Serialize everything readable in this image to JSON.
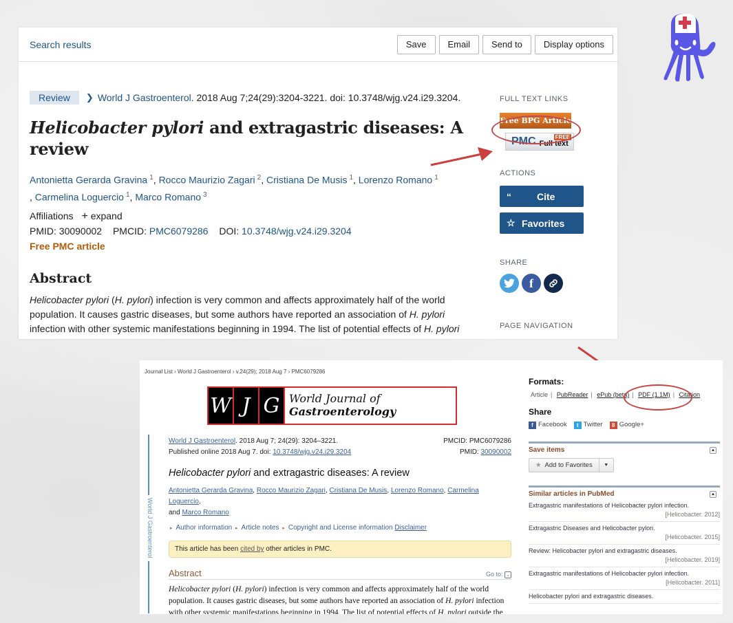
{
  "pubmed": {
    "topbar": {
      "search_results": "Search results",
      "buttons": [
        "Save",
        "Email",
        "Send to",
        "Display options"
      ]
    },
    "article_type": "Review",
    "citation": {
      "journal": "World J Gastroenterol",
      "rest": ". 2018 Aug 7;24(29):3204-3221. doi: 10.3748/wjg.v24.i29.3204."
    },
    "title": {
      "italic": "Helicobacter pylori",
      "rest": " and extragastric diseases: A review"
    },
    "authors": [
      {
        "name": "Antonietta Gerarda Gravina",
        "aff": "1"
      },
      {
        "name": "Rocco Maurizio Zagari",
        "aff": "2"
      },
      {
        "name": "Cristiana De Musis",
        "aff": "1"
      },
      {
        "name": "Lorenzo Romano",
        "aff": "1"
      },
      {
        "name": "Carmelina Loguercio",
        "aff": "1"
      },
      {
        "name": "Marco Romano",
        "aff": "3"
      }
    ],
    "affiliations_label": "Affiliations",
    "expand_label": "expand",
    "ids": {
      "pmid_label": "PMID:",
      "pmid": "30090002",
      "pmcid_label": "PMCID:",
      "pmcid": "PMC6079286",
      "doi_label": "DOI:",
      "doi": "10.3748/wjg.v24.i29.3204"
    },
    "free_pmc": "Free PMC article",
    "abstract_heading": "Abstract",
    "abstract": {
      "s1_italic": "Helicobacter pylori",
      "s1_a": " (",
      "s1_italic2": "H. pylori",
      "s1_b": ") infection is very common and affects approximately half of the world population. It causes gastric diseases, but some authors have reported an association of ",
      "s1_italic3": "H. pylori",
      "s1_c": " infection with other systemic manifestations beginning in 1994. The list of potential effects of ",
      "s1_italic4": "H. pylori"
    },
    "sidebar": {
      "full_text_links": "FULL TEXT LINKS",
      "bpg_button": "Free BPG Article",
      "pmc_logo": "PMC",
      "pmc_full_text": "Full text",
      "pmc_free": "FREE",
      "actions": "ACTIONS",
      "cite": "Cite",
      "favorites": "Favorites",
      "share": "SHARE",
      "page_navigation": "PAGE NAVIGATION"
    }
  },
  "pmc": {
    "breadcrumb": "Journal List › World J Gastroenterol › v.24(29); 2018 Aug 7 › PMC6079286",
    "logo": {
      "letters": [
        "W",
        "J",
        "G"
      ],
      "line1": "World Journal of",
      "line2": "Gastroenterology"
    },
    "spine_label": "World J Gastroenterol",
    "citation_journal": "World J Gastroenterol",
    "citation_rest": ". 2018 Aug 7; 24(29): 3204–3221.",
    "published": "Published online 2018 Aug 7. doi: ",
    "doi": "10.3748/wjg.v24.i29.3204",
    "pmcid_label": "PMCID: PMC6079286",
    "pmid_label": "PMID: ",
    "pmid": "30090002",
    "title_italic": "Helicobacter pylori",
    "title_rest": " and extragastric diseases: A review",
    "authors": [
      "Antonietta Gerarda Gravina",
      "Rocco Maurizio Zagari",
      "Cristiana De Musis",
      "Lorenzo Romano",
      "Carmelina Loguercio",
      "Marco Romano"
    ],
    "and_label": "and",
    "info_links": [
      "Author information",
      "Article notes",
      "Copyright and License information"
    ],
    "disclaimer": "Disclaimer",
    "cited_by": {
      "pre": "This article has been ",
      "link": "cited by",
      "post": " other articles in PMC."
    },
    "abstract_heading": "Abstract",
    "goto_label": "Go to:",
    "abstract": {
      "a_i": "Helicobacter pylori",
      "a_1": " (",
      "a_i2": "H. pylori",
      "a_2": ") infection is very common and affects approximately half of the world population. It causes gastric diseases, but some authors have reported an association of ",
      "a_i3": "H. pylori",
      "a_3": " infection with other systemic manifestations beginning in 1994. The list of potential effects of ",
      "a_i4": "H. pylori",
      "a_4": " outside the"
    },
    "sidebar": {
      "formats_heading": "Formats:",
      "formats": [
        "Article",
        "PubReader",
        "ePub (beta)",
        "PDF (1.1M)",
        "Citation"
      ],
      "share_heading": "Share",
      "share": [
        "Facebook",
        "Twitter",
        "Google+"
      ],
      "save_items": "Save items",
      "add_to_favorites": "Add to Favorites",
      "similar_heading": "Similar articles in PubMed",
      "similar": [
        {
          "title": "Extragastric manifestations of Helicobacter pylori infection.",
          "source": "[Helicobacter. 2012]"
        },
        {
          "title": "Extragastric Diseases and Helicobacter pylori.",
          "source": "[Helicobacter. 2015]"
        },
        {
          "title": "Review: Helicobacter pylori and extragastric diseases.",
          "source": "[Helicobacter. 2019]"
        },
        {
          "title": "Extragastric manifestations of Helicobacter pylori infection.",
          "source": "[Helicobacter. 2011]"
        },
        {
          "title": "Helicobacter pylori and extragastric diseases.",
          "source": ""
        }
      ]
    }
  },
  "colors": {
    "pubmed_link": "#20558a",
    "action_button": "#20558a",
    "free_pmc": "#b45c0a",
    "annotation_red": "#c9403f",
    "mascot": "#5a57e6"
  }
}
